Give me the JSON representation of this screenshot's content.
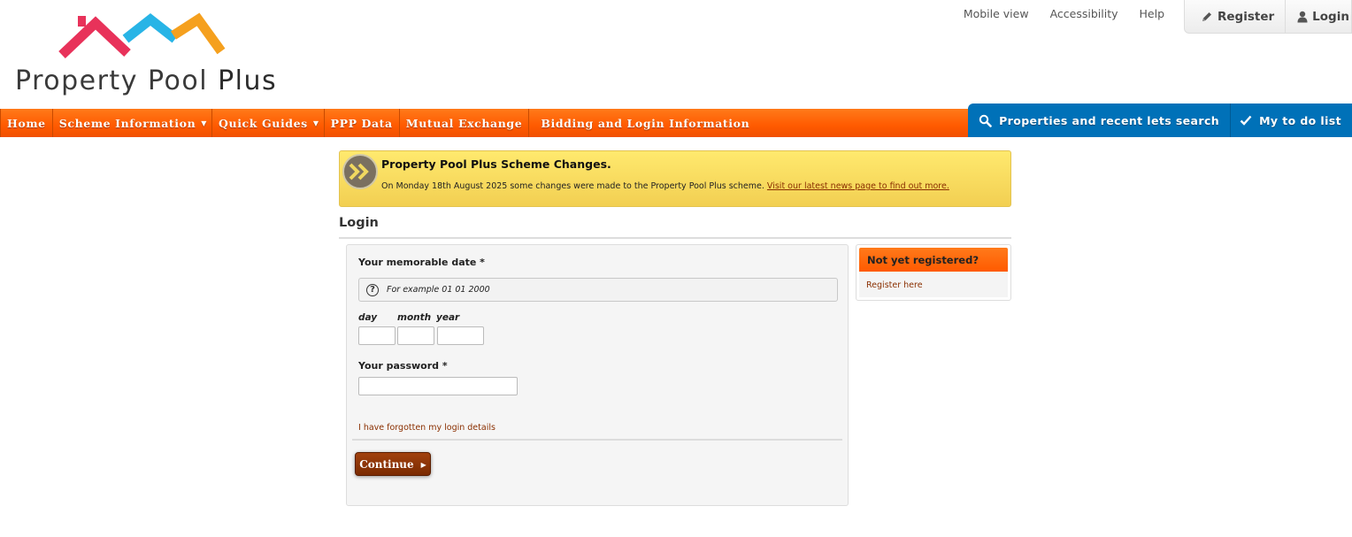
{
  "logo": {
    "text_light": "Property Pool ",
    "text_bold": "Plus",
    "roof_colors": [
      "#e8325a",
      "#28b4e6",
      "#f5a01e"
    ]
  },
  "top_links": [
    "Mobile view",
    "Accessibility",
    "Help"
  ],
  "auth": {
    "register": "Register",
    "login": "Login"
  },
  "nav": {
    "items": [
      {
        "label": "Home",
        "dropdown": false
      },
      {
        "label": "Scheme Information",
        "dropdown": true
      },
      {
        "label": "Quick Guides",
        "dropdown": true
      },
      {
        "label": "PPP Data",
        "dropdown": false
      },
      {
        "label": "Mutual Exchange",
        "dropdown": false
      },
      {
        "label": "Bidding and Login Information",
        "dropdown": false
      }
    ],
    "right": {
      "search": "Properties and recent lets search",
      "todo": "My to do list"
    },
    "accent": "#ff6a00",
    "right_accent": "#0071b8"
  },
  "banner": {
    "title": "Property Pool Plus Scheme Changes.",
    "body": "On Monday 18th August 2025 some changes were made to the Property Pool Plus scheme. ",
    "link": "Visit our latest news page to find out more."
  },
  "page_title": "Login",
  "form": {
    "memorable_label": "Your memorable date *",
    "hint": "For example 01 01 2000",
    "day_label": "day",
    "month_label": "month",
    "year_label": "year",
    "day_value": "",
    "month_value": "",
    "year_value": "",
    "password_label": "Your password *",
    "password_value": "",
    "forgot": "I have forgotten my login details",
    "continue": "Continue"
  },
  "side": {
    "title": "Not yet registered?",
    "link": "Register here"
  }
}
